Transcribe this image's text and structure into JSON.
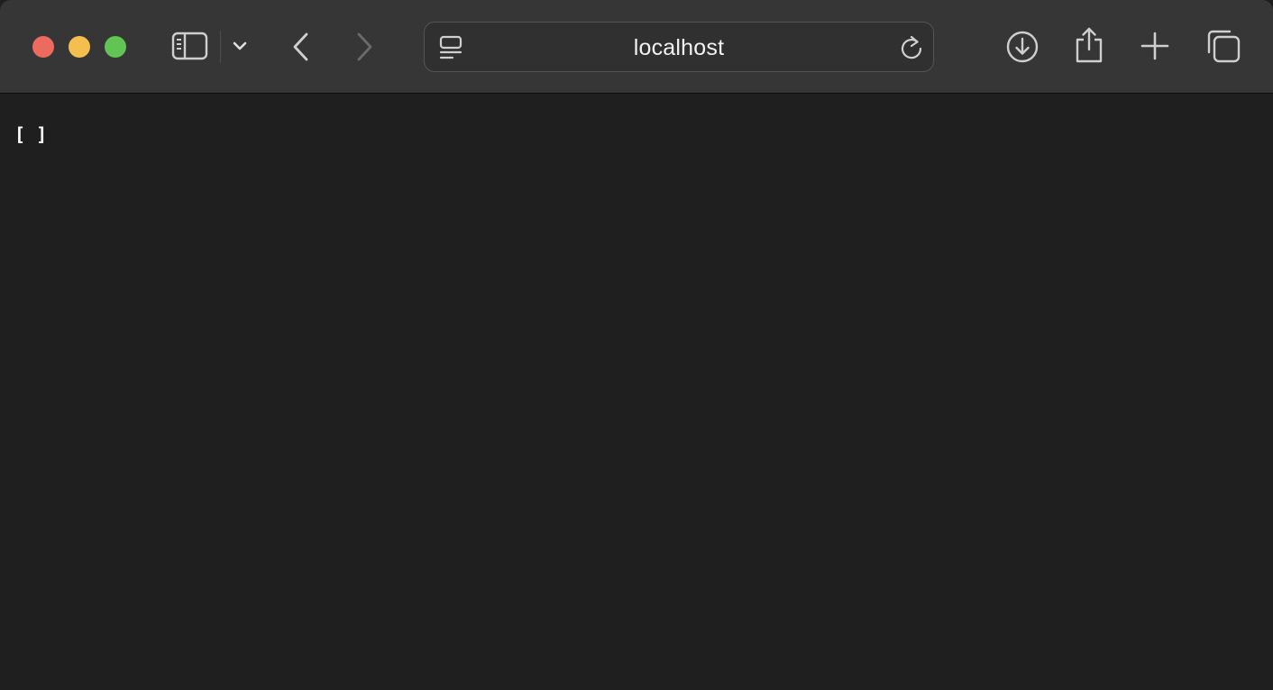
{
  "colors": {
    "traffic_close": "#ec6a5e",
    "traffic_minimize": "#f4bf4f",
    "traffic_zoom": "#61c554",
    "toolbar_bg": "#363636",
    "content_bg": "#1f1f1f",
    "icon_active": "#cfcfcf",
    "icon_disabled": "#6a6a6a"
  },
  "toolbar": {
    "icons": {
      "sidebar": "sidebar-icon",
      "sidebar_menu": "chevron-down-icon",
      "back": "chevron-left-icon",
      "forward": "chevron-right-icon",
      "download": "download-icon",
      "share": "share-icon",
      "new_tab": "plus-icon",
      "tab_overview": "tabs-overview-icon"
    },
    "forward_enabled": false
  },
  "address_bar": {
    "url": "localhost",
    "icons": {
      "page_menu": "page-menu-icon",
      "reload": "reload-icon"
    }
  },
  "content": {
    "text": "[ ]"
  }
}
